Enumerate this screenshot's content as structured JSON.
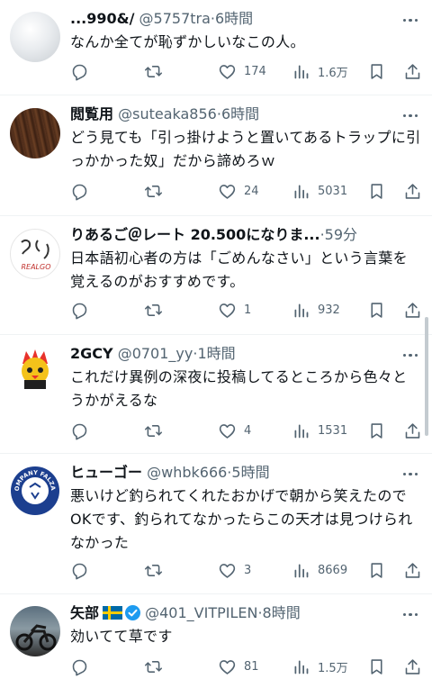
{
  "tweets": [
    {
      "name": "...990&/",
      "handle": "@5757tra",
      "dot": "·",
      "time": "6時間",
      "text": "なんか全てが恥ずかしいなこの人。",
      "replies": "",
      "retweets": "",
      "likes": "174",
      "views": "1.6万"
    },
    {
      "name": "閲覧用",
      "handle": "@suteaka856",
      "dot": "·",
      "time": "6時間",
      "text": "どう見ても「引っ掛けようと置いてあるトラップに引っかかった奴」だから諦めろｗ",
      "replies": "",
      "retweets": "",
      "likes": "24",
      "views": "5031"
    },
    {
      "name": "りあるご＠レート 20.500になりま...",
      "handle": "",
      "dot": "·",
      "time": "59分",
      "text": "日本語初心者の方は「ごめんなさい」という言葉を覚えるのがおすすめです。",
      "replies": "",
      "retweets": "",
      "likes": "1",
      "views": "932",
      "avatar_text": "REALGO"
    },
    {
      "name": "2GCY",
      "handle": "@0701_yy",
      "dot": "·",
      "time": "1時間",
      "text": "これだけ異例の深夜に投稿してるところから色々とうかがえるな",
      "replies": "",
      "retweets": "",
      "likes": "4",
      "views": "1531"
    },
    {
      "name": "ヒューゴー",
      "handle": "@whbk666",
      "dot": "·",
      "time": "5時間",
      "text": "悪いけど釣られてくれたおかげで朝から笑えたのでOKです、釣られてなかったらこの天才は見つけられなかった",
      "replies": "",
      "retweets": "",
      "likes": "3",
      "views": "8669",
      "avatar_text": "COMPANY FALZAN"
    },
    {
      "name": "矢部",
      "handle": "@401_VITPILEN",
      "dot": "·",
      "time": "8時間",
      "text": "効いてて草です",
      "replies": "",
      "retweets": "",
      "likes": "81",
      "views": "1.5万"
    }
  ],
  "icons": {
    "reply": "reply-icon",
    "retweet": "retweet-icon",
    "like": "like-icon",
    "views": "views-icon",
    "bookmark": "bookmark-icon",
    "share": "share-icon",
    "more": "more-icon",
    "verified": "verified-badge-icon",
    "flag": "sweden-flag-icon"
  },
  "colors": {
    "text": "#0f1419",
    "secondary": "#536471",
    "verified": "#1d9bf0",
    "divider": "#eff3f4"
  }
}
